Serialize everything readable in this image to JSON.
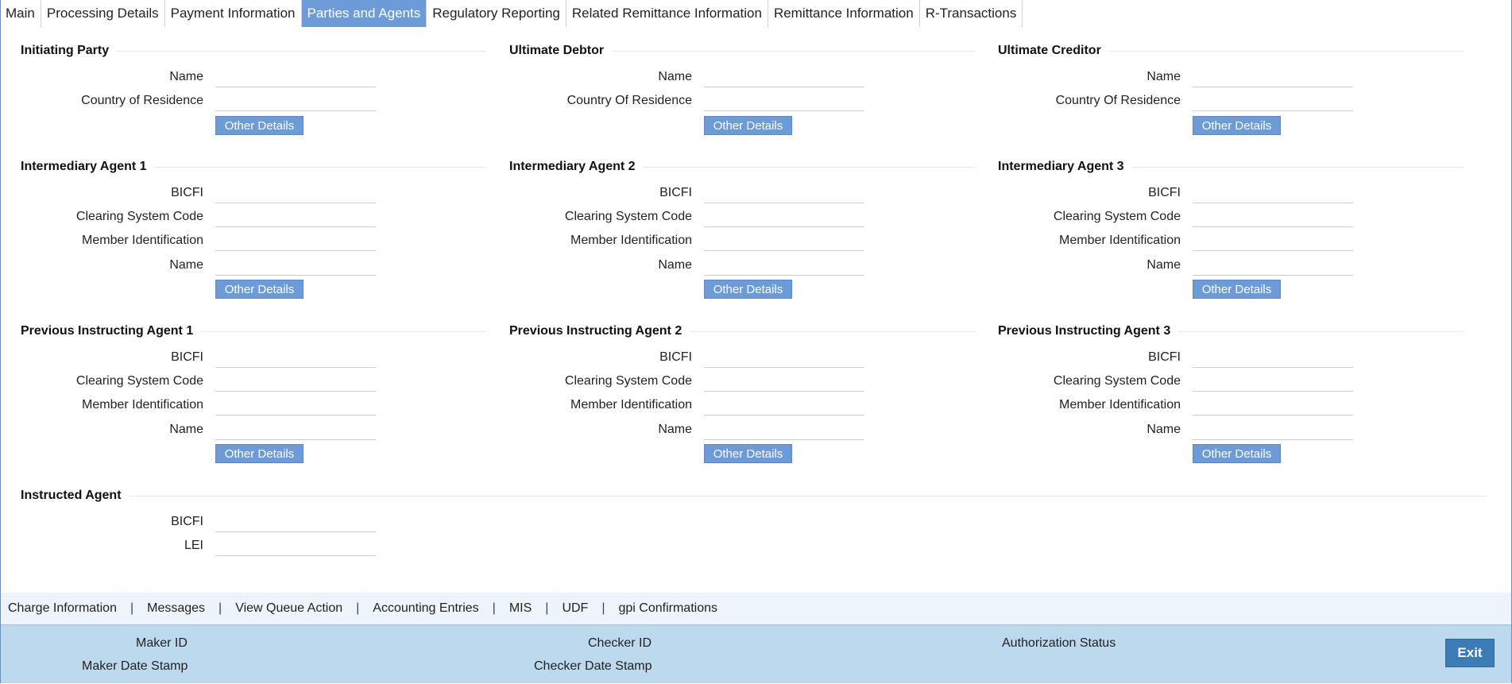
{
  "tabs": [
    "Main",
    "Processing Details",
    "Payment Information",
    "Parties and Agents",
    "Regulatory Reporting",
    "Related Remittance Information",
    "Remittance Information",
    "R-Transactions"
  ],
  "active_tab": "Parties and Agents",
  "sections": {
    "initiating_party": {
      "title": "Initiating Party",
      "fields": [
        "Name",
        "Country of Residence"
      ],
      "button": "Other Details"
    },
    "ultimate_debtor": {
      "title": "Ultimate Debtor",
      "fields": [
        "Name",
        "Country Of Residence"
      ],
      "button": "Other Details"
    },
    "ultimate_creditor": {
      "title": "Ultimate Creditor",
      "fields": [
        "Name",
        "Country Of Residence"
      ],
      "button": "Other Details"
    },
    "intermediary_agent_1": {
      "title": "Intermediary Agent 1",
      "fields": [
        "BICFI",
        "Clearing System Code",
        "Member Identification",
        "Name"
      ],
      "button": "Other Details"
    },
    "intermediary_agent_2": {
      "title": "Intermediary Agent 2",
      "fields": [
        "BICFI",
        "Clearing System Code",
        "Member Identification",
        "Name"
      ],
      "button": "Other Details"
    },
    "intermediary_agent_3": {
      "title": "Intermediary Agent 3",
      "fields": [
        "BICFI",
        "Clearing System Code",
        "Member Identification",
        "Name"
      ],
      "button": "Other Details"
    },
    "previous_instructing_agent_1": {
      "title": "Previous Instructing Agent 1",
      "fields": [
        "BICFI",
        "Clearing System Code",
        "Member Identification",
        "Name"
      ],
      "button": "Other Details"
    },
    "previous_instructing_agent_2": {
      "title": "Previous Instructing Agent 2",
      "fields": [
        "BICFI",
        "Clearing System Code",
        "Member Identification",
        "Name"
      ],
      "button": "Other Details"
    },
    "previous_instructing_agent_3": {
      "title": "Previous Instructing Agent 3",
      "fields": [
        "BICFI",
        "Clearing System Code",
        "Member Identification",
        "Name"
      ],
      "button": "Other Details"
    },
    "instructed_agent": {
      "title": "Instructed Agent",
      "fields": [
        "BICFI",
        "LEI"
      ]
    }
  },
  "bottom_links": [
    "Charge Information",
    "Messages",
    "View Queue Action",
    "Accounting Entries",
    "MIS",
    "UDF",
    "gpi Confirmations"
  ],
  "link_separator": "|",
  "footer": {
    "maker_id": "Maker ID",
    "maker_date_stamp": "Maker Date Stamp",
    "checker_id": "Checker ID",
    "checker_date_stamp": "Checker Date Stamp",
    "authorization_status": "Authorization Status",
    "exit_label": "Exit"
  },
  "colors": {
    "accent": "#6c9bd8",
    "footer_bg": "#bdd9ee",
    "exit_bg": "#3c7bb6",
    "linkbar_bg": "#eef4fb"
  }
}
